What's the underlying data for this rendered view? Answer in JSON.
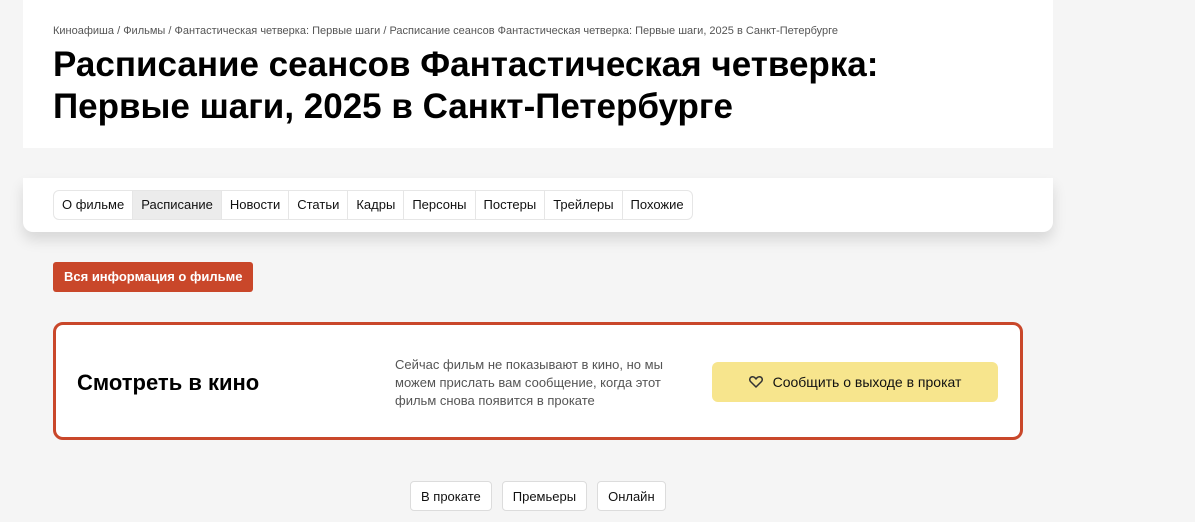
{
  "breadcrumb": {
    "items": [
      "Киноафиша",
      "Фильмы",
      "Фантастическая четверка: Первые шаги",
      "Расписание сеансов Фантастическая четверка: Первые шаги, 2025 в Санкт-Петербурге"
    ],
    "separator": "/"
  },
  "page_title": "Расписание сеансов Фантастическая четверка: Первые шаги, 2025 в Санкт-Петербурге",
  "tabs": [
    {
      "label": "О фильме",
      "active": false
    },
    {
      "label": "Расписание",
      "active": true
    },
    {
      "label": "Новости",
      "active": false
    },
    {
      "label": "Статьи",
      "active": false
    },
    {
      "label": "Кадры",
      "active": false
    },
    {
      "label": "Персоны",
      "active": false
    },
    {
      "label": "Постеры",
      "active": false
    },
    {
      "label": "Трейлеры",
      "active": false
    },
    {
      "label": "Похожие",
      "active": false
    }
  ],
  "info_button": {
    "label": "Вся информация о фильме"
  },
  "watch": {
    "title": "Смотреть в кино",
    "text": "Сейчас фильм не показывают в кино, но мы можем прислать вам сообщение, когда этот фильм снова появится в прокате",
    "notify_label": "Сообщить о выходе в прокат",
    "notify_icon": "heart-icon"
  },
  "filters": [
    "В прокате",
    "Премьеры",
    "Онлайн"
  ],
  "colors": {
    "accent": "#c9472a",
    "notify_bg": "#f7e58d",
    "page_bg": "#f5f5f5"
  }
}
